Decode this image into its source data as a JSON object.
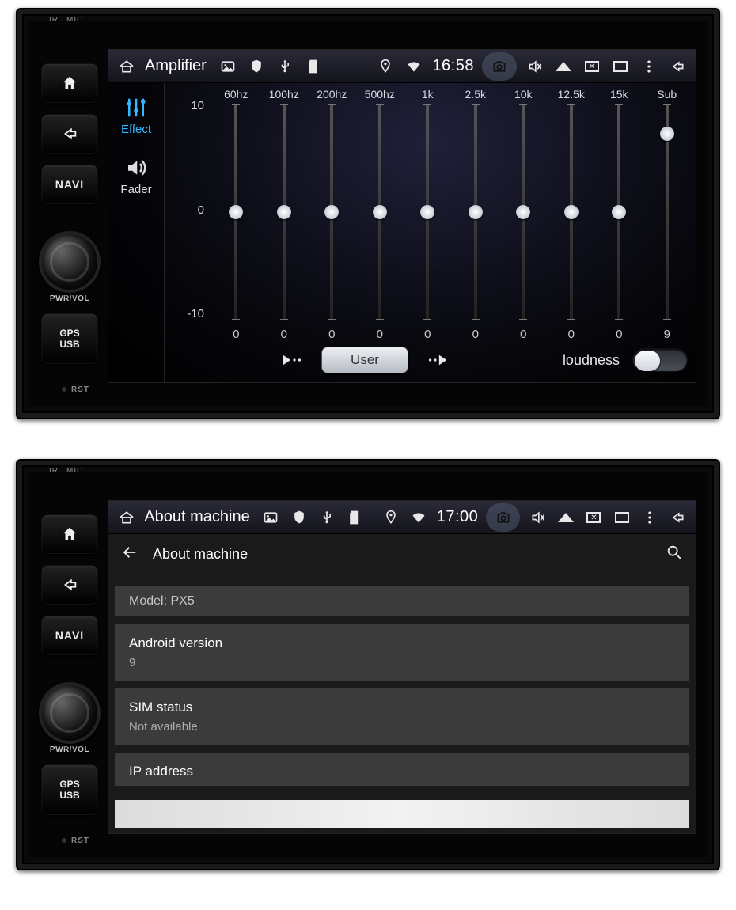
{
  "bezel": {
    "ir": "IR",
    "mic": "MIC",
    "pwrvol": "PWR/VOL",
    "rst": "RST",
    "navi": "NAVI",
    "gps": "GPS",
    "usb": "USB"
  },
  "top": {
    "statusbar": {
      "title": "Amplifier",
      "time": "16:58"
    },
    "amp": {
      "tabs": {
        "effect": "Effect",
        "fader": "Fader"
      },
      "yscale": {
        "max": "10",
        "mid": "0",
        "min": "-10"
      },
      "bands": [
        {
          "label": "60hz",
          "value": "0",
          "pos": 50
        },
        {
          "label": "100hz",
          "value": "0",
          "pos": 50
        },
        {
          "label": "200hz",
          "value": "0",
          "pos": 50
        },
        {
          "label": "500hz",
          "value": "0",
          "pos": 50
        },
        {
          "label": "1k",
          "value": "0",
          "pos": 50
        },
        {
          "label": "2.5k",
          "value": "0",
          "pos": 50
        },
        {
          "label": "10k",
          "value": "0",
          "pos": 50
        },
        {
          "label": "12.5k",
          "value": "0",
          "pos": 50
        },
        {
          "label": "15k",
          "value": "0",
          "pos": 50
        },
        {
          "label": "Sub",
          "value": "9",
          "pos": 14
        }
      ],
      "preset": "User",
      "loudness_label": "loudness",
      "loudness_on": false
    }
  },
  "bottom": {
    "statusbar": {
      "title": "About machine",
      "time": "17:00"
    },
    "settings": {
      "header": "About machine",
      "rows": [
        {
          "kind": "model",
          "primary": "Model: PX5"
        },
        {
          "kind": "pair",
          "primary": "Android version",
          "secondary": "9"
        },
        {
          "kind": "pair",
          "primary": "SIM status",
          "secondary": "Not available"
        },
        {
          "kind": "cut",
          "primary": "IP address"
        }
      ]
    }
  }
}
